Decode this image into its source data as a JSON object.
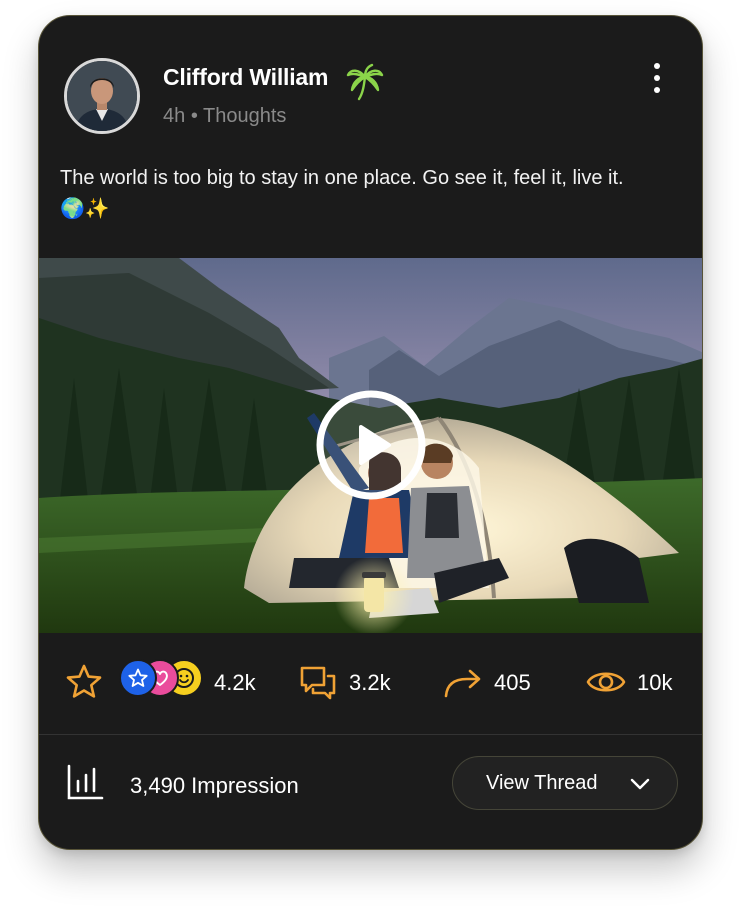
{
  "post": {
    "author_name": "Clifford William",
    "time_ago": "4h",
    "separator": "•",
    "category": "Thoughts",
    "body": "The world is too big to stay in one place. Go see it, feel it, live it. 🌍✨"
  },
  "stats": {
    "reactions_count": "4.2k",
    "comments_count": "3.2k",
    "shares_count": "405",
    "views_count": "10k"
  },
  "footer": {
    "impressions_label": "3,490 Impression",
    "view_thread_label": "View Thread"
  },
  "icons": {
    "author_badge": "palm-tree-icon",
    "menu": "more-vertical-icon",
    "favorite": "star-icon",
    "reactions": [
      "star-reaction-icon",
      "heart-reaction-icon",
      "smiley-reaction-icon"
    ],
    "comments": "comment-bubbles-icon",
    "share": "share-arrow-icon",
    "views": "eye-icon",
    "impressions": "bar-chart-icon",
    "dropdown": "chevron-down-icon",
    "media_play": "play-icon"
  },
  "colors": {
    "card_background": "#1b1b1b",
    "card_border": "#585438",
    "accent_orange": "#f0a235",
    "badge_green": "#8bd44a",
    "reaction_blue": "#1e62e8",
    "reaction_pink": "#ea4c9c",
    "reaction_yellow": "#f6cf1f"
  }
}
